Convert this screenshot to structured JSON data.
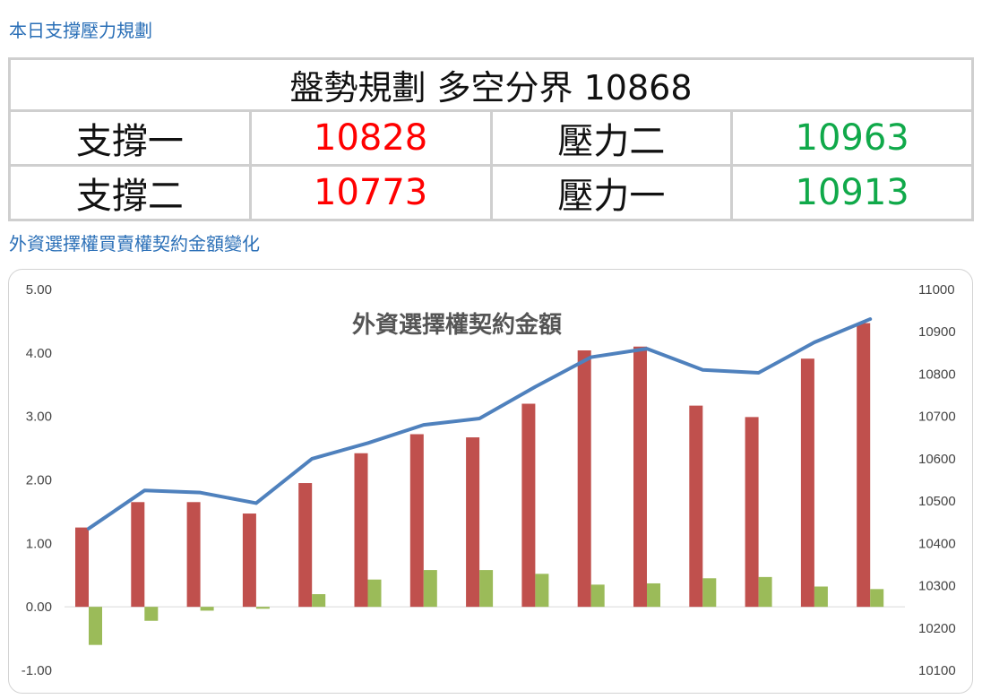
{
  "section1_title": "本日支撐壓力規劃",
  "section2_title": "外資選擇權買賣權契約金額變化",
  "plan_table": {
    "header": "盤勢規劃 多空分界 10868",
    "rows": [
      {
        "label_a": "支撐一",
        "value_a": "10828",
        "label_b": "壓力二",
        "value_b": "10963"
      },
      {
        "label_a": "支撐二",
        "value_a": "10773",
        "label_b": "壓力一",
        "value_b": "10913"
      }
    ]
  },
  "colors": {
    "support": "#ff0000",
    "pressure": "#10a94a",
    "bar_red": "#c0504d",
    "bar_green": "#9bbb59",
    "line": "#4f81bd"
  },
  "chart_data": {
    "type": "bar",
    "title": "外資選擇權契約金額",
    "x": [
      1,
      2,
      3,
      4,
      5,
      6,
      7,
      8,
      9,
      10,
      11,
      12,
      13,
      14,
      15
    ],
    "series": [
      {
        "axis": "left",
        "type": "bar",
        "color": "#c0504d",
        "values": [
          1.25,
          1.65,
          1.65,
          1.47,
          1.95,
          2.42,
          2.72,
          2.67,
          3.2,
          4.04,
          4.1,
          3.17,
          2.99,
          3.91,
          4.47
        ]
      },
      {
        "axis": "left",
        "type": "bar",
        "color": "#9bbb59",
        "values": [
          -0.6,
          -0.22,
          -0.06,
          -0.03,
          0.2,
          0.43,
          0.58,
          0.58,
          0.52,
          0.35,
          0.37,
          0.45,
          0.47,
          0.32,
          0.28
        ]
      },
      {
        "axis": "right",
        "type": "line",
        "color": "#4f81bd",
        "values": [
          10435,
          10525,
          10520,
          10495,
          10600,
          10637,
          10680,
          10695,
          10770,
          10840,
          10860,
          10810,
          10803,
          10875,
          10930
        ]
      }
    ],
    "ylim_left": [
      -1,
      5
    ],
    "yticks_left": [
      "5.00",
      "4.00",
      "3.00",
      "2.00",
      "1.00",
      "0.00",
      "-1.00"
    ],
    "ylim_right": [
      10100,
      11000
    ],
    "yticks_right": [
      "11000",
      "10900",
      "10800",
      "10700",
      "10600",
      "10500",
      "10400",
      "10300",
      "10200",
      "10100"
    ],
    "grid": false
  }
}
